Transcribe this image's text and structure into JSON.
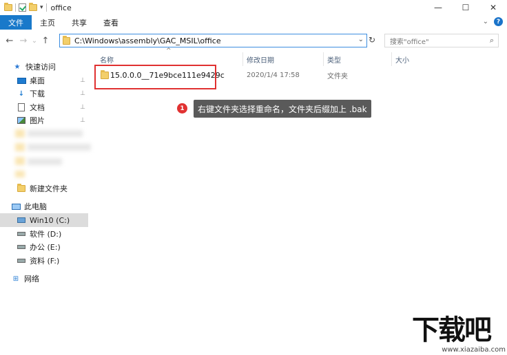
{
  "window": {
    "title": "office",
    "minimize": "—",
    "maximize": "☐",
    "close": "✕"
  },
  "ribbon": {
    "tabs": [
      {
        "label": "文件",
        "active": true
      },
      {
        "label": "主页",
        "active": false
      },
      {
        "label": "共享",
        "active": false
      },
      {
        "label": "查看",
        "active": false
      }
    ],
    "help": "?",
    "accent_color": "#1979ca"
  },
  "nav": {
    "back": "←",
    "forward": "→",
    "recent": "⌄",
    "up": "↑",
    "address": "C:\\Windows\\assembly\\GAC_MSIL\\office",
    "refresh": "↻",
    "search_placeholder": "搜索\"office\"",
    "search_icon": "⌕"
  },
  "sidebar": {
    "quick_access": "快速访问",
    "items": [
      {
        "label": "桌面",
        "icon": "desktop-icon",
        "pinned": true
      },
      {
        "label": "下载",
        "icon": "download-icon",
        "pinned": true
      },
      {
        "label": "文档",
        "icon": "document-icon",
        "pinned": true
      },
      {
        "label": "图片",
        "icon": "pictures-icon",
        "pinned": true
      }
    ],
    "new_folder": "新建文件夹",
    "this_pc": "此电脑",
    "drives": [
      {
        "label": "Win10 (C:)",
        "selected": true
      },
      {
        "label": "软件 (D:)",
        "selected": false
      },
      {
        "label": "办公 (E:)",
        "selected": false
      },
      {
        "label": "资料 (F:)",
        "selected": false
      }
    ],
    "network": "网络",
    "pin_glyph": "📌"
  },
  "columns": {
    "name": "名称",
    "date": "修改日期",
    "type": "类型",
    "size": "大小",
    "sort_glyph": "^"
  },
  "files": [
    {
      "name": "15.0.0.0__71e9bce111e9429c",
      "date": "2020/1/4 17:58",
      "type": "文件夹",
      "size": ""
    }
  ],
  "callout": {
    "number": "1",
    "text": "右键文件夹选择重命名，文件夹后缀加上 .bak",
    "highlight_color": "#e03030"
  },
  "watermark": {
    "main": "下载吧",
    "sub": "www.xiazaiba.com"
  }
}
